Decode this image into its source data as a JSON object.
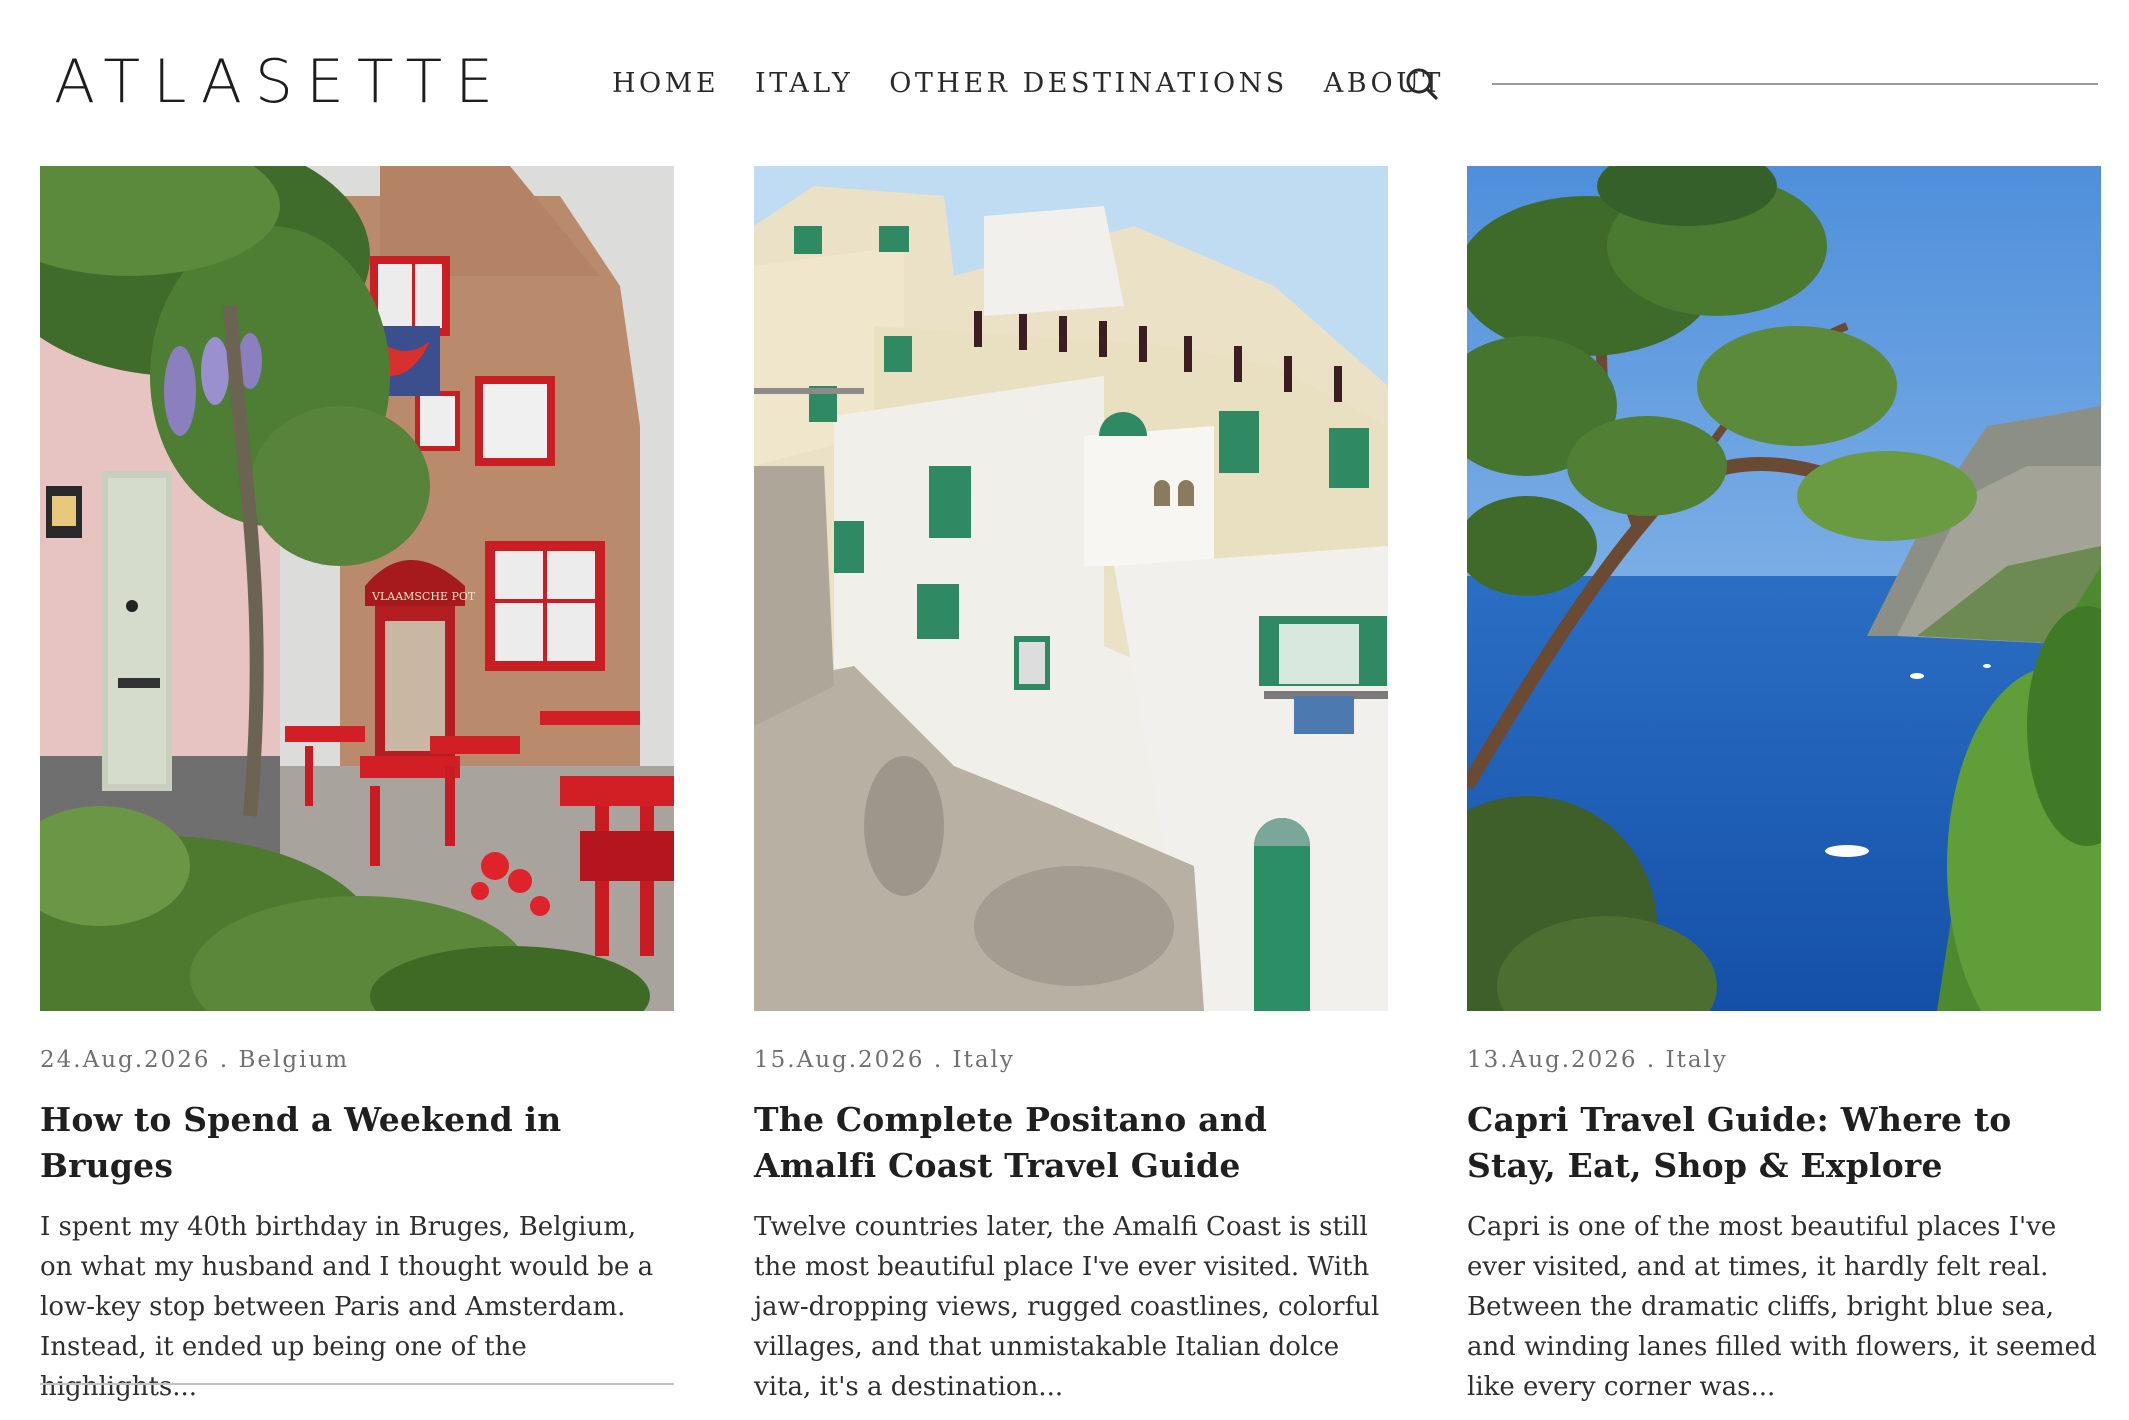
{
  "site": {
    "logo": "ATLASETTE"
  },
  "nav": {
    "items": [
      {
        "label": "HOME"
      },
      {
        "label": "ITALY"
      },
      {
        "label": "OTHER DESTINATIONS"
      },
      {
        "label": "ABOUT"
      }
    ],
    "search_icon": "search-icon"
  },
  "posts": [
    {
      "date": "24.Aug.2026",
      "category": "Belgium",
      "meta": "24.Aug.2026 . Belgium",
      "title": "How to Spend a Weekend in Bruges",
      "excerpt": "I spent my 40th birthday in Bruges, Belgium, on what my husband and I thought would be a low-key stop between Paris and Amsterdam. Instead, it ended up being one of the highlights...",
      "image_sign": "VLAAMSCHE POT"
    },
    {
      "date": "15.Aug.2026",
      "category": "Italy",
      "meta": "15.Aug.2026 . Italy",
      "title": "The Complete Positano and Amalfi Coast Travel Guide",
      "excerpt": "Twelve countries later, the Amalfi Coast is still the most beautiful place I've ever visited. With jaw-dropping views, rugged coastlines, colorful villages, and that unmistakable Italian dolce vita, it's a destination..."
    },
    {
      "date": "13.Aug.2026",
      "category": "Italy",
      "meta": "13.Aug.2026 . Italy",
      "title": "Capri Travel Guide: Where to Stay, Eat, Shop & Explore",
      "excerpt": "Capri is one of the most beautiful places I've ever visited, and at times, it hardly felt real. Between the dramatic cliffs, bright blue sea, and winding lanes filled with flowers, it seemed like every corner was..."
    }
  ],
  "colors": {
    "text": "#2b2b2b",
    "meta": "#707070",
    "rule": "#9a9a9a",
    "background": "#ffffff"
  }
}
